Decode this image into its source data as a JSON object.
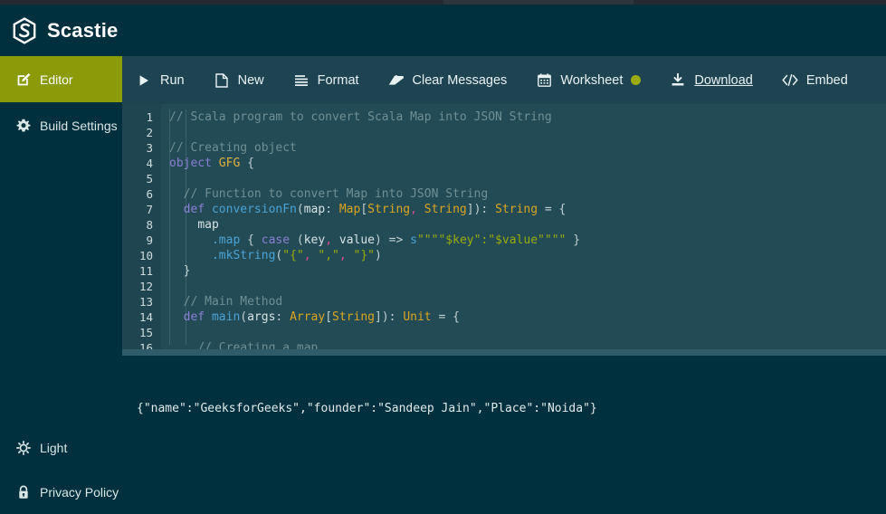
{
  "header": {
    "brand": "Scastie",
    "logo_icon": "scastie-hexagon-logo"
  },
  "colors": {
    "header_bg": "#00303d",
    "toolbar_bg": "#1e4452",
    "editor_bg": "#234b56",
    "gutter_bg": "#1f4550",
    "accent_olive": "#8a9a08",
    "status_dot": "#9aab0a",
    "output_bg": "#00303d"
  },
  "sidebar": {
    "items": [
      {
        "label": "Editor",
        "icon": "edit-pencil-square-icon",
        "active": true
      },
      {
        "label": "Build Settings",
        "icon": "gear-icon",
        "active": false
      }
    ],
    "bottom_items": [
      {
        "label": "Light",
        "icon": "sun-icon"
      },
      {
        "label": "Privacy Policy",
        "icon": "lock-icon"
      }
    ]
  },
  "toolbar": {
    "items": [
      {
        "label": "Run",
        "icon": "play-triangle-icon",
        "underlined": false,
        "dot": false
      },
      {
        "label": "New",
        "icon": "file-page-icon",
        "underlined": false,
        "dot": false
      },
      {
        "label": "Format",
        "icon": "format-lines-icon",
        "underlined": false,
        "dot": false
      },
      {
        "label": "Clear Messages",
        "icon": "eraser-icon",
        "underlined": false,
        "dot": false
      },
      {
        "label": "Worksheet",
        "icon": "calendar-icon",
        "underlined": false,
        "dot": true
      },
      {
        "label": "Download",
        "icon": "download-arrow-icon",
        "underlined": true,
        "dot": false
      },
      {
        "label": "Embed",
        "icon": "code-brackets-icon",
        "underlined": false,
        "dot": false
      }
    ]
  },
  "editor": {
    "line_numbers": [
      "1",
      "2",
      "3",
      "4",
      "5",
      "6",
      "7",
      "8",
      "9",
      "10",
      "11",
      "12",
      "13",
      "14",
      "15",
      "16"
    ],
    "lines": [
      {
        "n": "1",
        "text": "// Scala program to convert Scala Map into JSON String"
      },
      {
        "n": "2",
        "text": ""
      },
      {
        "n": "3",
        "text": "// Creating object"
      },
      {
        "n": "4",
        "text": "object GFG {"
      },
      {
        "n": "5",
        "text": ""
      },
      {
        "n": "6",
        "text": "  // Function to convert Map into JSON String"
      },
      {
        "n": "7",
        "text": "  def conversionFn(map: Map[String, String]): String = {"
      },
      {
        "n": "8",
        "text": "    map"
      },
      {
        "n": "9",
        "text": "      .map { case (key, value) => s\"\"\"\"$key\":\"$value\"\"\"\" }"
      },
      {
        "n": "10",
        "text": "      .mkString(\"{\", \",\", \"}\")"
      },
      {
        "n": "11",
        "text": "  }"
      },
      {
        "n": "12",
        "text": ""
      },
      {
        "n": "13",
        "text": "  // Main Method"
      },
      {
        "n": "14",
        "text": "  def main(args: Array[String]): Unit = {"
      },
      {
        "n": "15",
        "text": ""
      },
      {
        "n": "16",
        "text": "    // Creating a map"
      }
    ]
  },
  "output": {
    "text": "{\"name\":\"GeeksforGeeks\",\"founder\":\"Sandeep Jain\",\"Place\":\"Noida\"}"
  }
}
